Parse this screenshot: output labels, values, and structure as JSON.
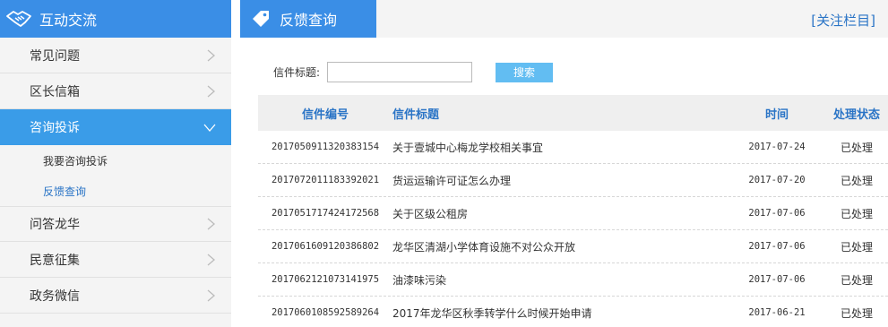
{
  "sidebar": {
    "header_title": "互动交流",
    "header_icon": "handshake-icon",
    "items": [
      {
        "label": "常见问题"
      },
      {
        "label": "区长信箱"
      },
      {
        "label": "咨询投诉"
      },
      {
        "label": "问答龙华"
      },
      {
        "label": "民意征集"
      },
      {
        "label": "政务微信"
      }
    ],
    "sub_items": [
      {
        "label": "我要咨询投诉"
      },
      {
        "label": "反馈查询"
      }
    ]
  },
  "main": {
    "title": "反馈查询",
    "title_icon": "tag-icon",
    "follow_label": "[关注栏目]",
    "search": {
      "label": "信件标题:",
      "placeholder": "",
      "value": "",
      "button_label": "搜索"
    },
    "table": {
      "headers": {
        "no": "信件编号",
        "title": "信件标题",
        "time": "时间",
        "status": "处理状态"
      },
      "rows": [
        {
          "no": "2017050911320383154",
          "title": "关于壹城中心梅龙学校相关事宜",
          "time": "2017-07-24",
          "status": "已处理"
        },
        {
          "no": "2017072011183392021",
          "title": "货运运输许可证怎么办理",
          "time": "2017-07-20",
          "status": "已处理"
        },
        {
          "no": "2017051717424172568",
          "title": "关于区级公租房",
          "time": "2017-07-06",
          "status": "已处理"
        },
        {
          "no": "2017061609120386802",
          "title": "龙华区清湖小学体育设施不对公众开放",
          "time": "2017-07-06",
          "status": "已处理"
        },
        {
          "no": "2017062121073141975",
          "title": "油漆味污染",
          "time": "2017-07-06",
          "status": "已处理"
        },
        {
          "no": "2017060108592589264",
          "title": "2017年龙华区秋季转学什么时候开始申请",
          "time": "2017-06-21",
          "status": "已处理"
        }
      ]
    }
  },
  "colors": {
    "accent": "#3a8ee6",
    "active_item": "#3a9ce8",
    "link": "#2a74c6",
    "button": "#62bdf2"
  }
}
